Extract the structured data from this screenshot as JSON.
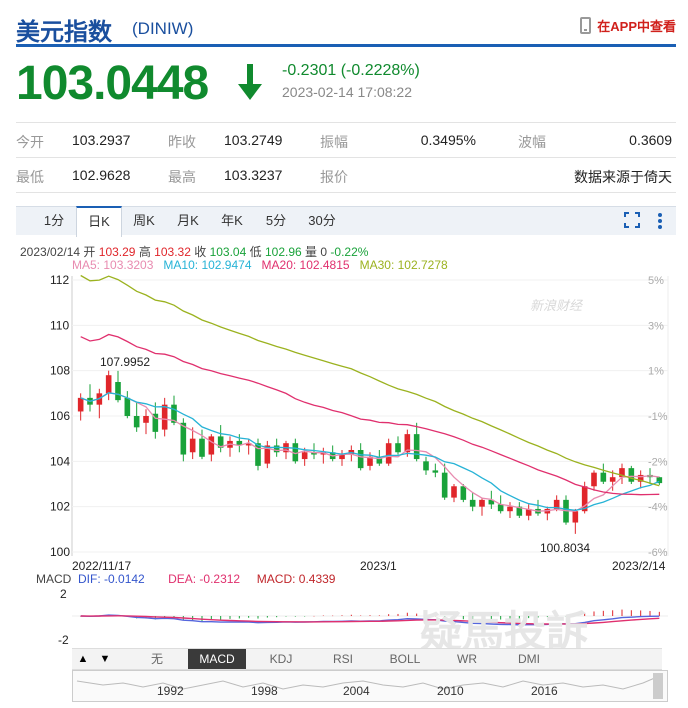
{
  "header": {
    "title": "美元指数",
    "code": "(DINIW)",
    "app_link": "在APP中查看"
  },
  "quote": {
    "price": "103.0448",
    "change": "-0.2301 (-0.2228%)",
    "time": "2023-02-14 17:08:22"
  },
  "stats": {
    "open_label": "今开",
    "open": "103.2937",
    "prev_label": "昨收",
    "prev": "103.2749",
    "amp_label": "振幅",
    "amp": "0.3495%",
    "wave_label": "波幅",
    "wave": "0.3609",
    "low_label": "最低",
    "low": "102.9628",
    "high_label": "最高",
    "high": "103.3237",
    "report_label": "报价",
    "source": "数据来源于倚天"
  },
  "tabs": [
    "1分",
    "日K",
    "周K",
    "月K",
    "年K",
    "5分",
    "30分"
  ],
  "active_tab": "日K",
  "info": {
    "date": "2023/02/14",
    "open_l": "开",
    "open": "103.29",
    "high_l": "高",
    "high": "103.32",
    "close_l": "收",
    "close": "103.04",
    "low_l": "低",
    "low": "102.96",
    "vol_l": "量",
    "vol": "0",
    "chg": "-0.22%"
  },
  "ma": {
    "ma5": "MA5: 103.3203",
    "ma10": "MA10: 102.9474",
    "ma20": "MA20: 102.4815",
    "ma30": "MA30: 102.7278"
  },
  "macd_info": {
    "label": "MACD",
    "dif": "DIF: -0.0142",
    "dea": "DEA: -0.2312",
    "macd": "MACD: 0.4339"
  },
  "indicators": [
    "无",
    "MACD",
    "KDJ",
    "RSI",
    "BOLL",
    "WR",
    "DMI"
  ],
  "active_indicator": "MACD",
  "nav_years": [
    "1992",
    "1998",
    "2004",
    "2010",
    "2016"
  ],
  "watermark": "新浪财经",
  "watermark2": "疑馬投訴",
  "colors": {
    "up": "#e0262b",
    "down": "#19a23a",
    "ma5": "#e88bb0",
    "ma10": "#27b3d6",
    "ma20": "#e0306e",
    "ma30": "#9bb21f",
    "dif": "#3355cc",
    "dea": "#e0306e"
  },
  "chart_data": {
    "type": "candlestick",
    "y_axis": {
      "ticks": [
        112,
        110,
        108,
        106,
        104,
        102,
        100
      ],
      "ylim": [
        100,
        112
      ]
    },
    "y_axis_right": {
      "ticks": [
        "5%",
        "3%",
        "1%",
        "-1%",
        "-2%",
        "-4%",
        "-6%"
      ]
    },
    "x_labels": [
      "2022/11/17",
      "2023/1",
      "2023/2/14"
    ],
    "annotations": {
      "max": "107.9952",
      "min": "100.8034"
    },
    "ohlc": [
      [
        106.2,
        107.0,
        105.8,
        106.8
      ],
      [
        106.8,
        107.4,
        106.2,
        106.5
      ],
      [
        106.5,
        107.2,
        105.9,
        107.0
      ],
      [
        107.0,
        108.0,
        106.7,
        107.8
      ],
      [
        107.5,
        107.99,
        106.6,
        106.7
      ],
      [
        106.8,
        107.1,
        105.9,
        106.0
      ],
      [
        106.0,
        106.6,
        105.3,
        105.5
      ],
      [
        105.7,
        106.3,
        105.2,
        106.0
      ],
      [
        106.1,
        106.6,
        105.0,
        105.3
      ],
      [
        105.4,
        106.8,
        105.1,
        106.5
      ],
      [
        106.5,
        106.9,
        105.6,
        105.7
      ],
      [
        105.7,
        105.9,
        104.0,
        104.3
      ],
      [
        104.4,
        105.5,
        104.1,
        105.0
      ],
      [
        105.0,
        105.4,
        104.1,
        104.2
      ],
      [
        104.3,
        105.2,
        104.0,
        105.1
      ],
      [
        105.1,
        105.6,
        104.4,
        104.6
      ],
      [
        104.6,
        105.1,
        104.2,
        104.9
      ],
      [
        104.9,
        105.2,
        104.4,
        104.7
      ],
      [
        104.7,
        105.0,
        104.3,
        104.8
      ],
      [
        104.8,
        105.0,
        103.6,
        103.8
      ],
      [
        103.9,
        104.9,
        103.7,
        104.7
      ],
      [
        104.7,
        105.0,
        104.2,
        104.4
      ],
      [
        104.4,
        104.9,
        104.1,
        104.8
      ],
      [
        104.8,
        105.0,
        103.9,
        104.0
      ],
      [
        104.1,
        104.6,
        103.8,
        104.4
      ],
      [
        104.4,
        104.8,
        104.1,
        104.3
      ],
      [
        104.3,
        104.6,
        103.9,
        104.4
      ],
      [
        104.4,
        104.7,
        104.0,
        104.1
      ],
      [
        104.1,
        104.5,
        103.8,
        104.3
      ],
      [
        104.3,
        104.7,
        104.0,
        104.5
      ],
      [
        104.5,
        104.8,
        103.6,
        103.7
      ],
      [
        103.8,
        104.4,
        103.6,
        104.2
      ],
      [
        104.2,
        104.5,
        103.8,
        103.9
      ],
      [
        103.9,
        105.0,
        103.8,
        104.8
      ],
      [
        104.8,
        105.1,
        104.3,
        104.4
      ],
      [
        104.4,
        105.4,
        104.2,
        105.2
      ],
      [
        105.2,
        105.7,
        104.0,
        104.1
      ],
      [
        104.0,
        104.2,
        103.4,
        103.6
      ],
      [
        103.6,
        103.9,
        103.3,
        103.5
      ],
      [
        103.5,
        103.9,
        102.3,
        102.4
      ],
      [
        102.4,
        103.0,
        102.2,
        102.9
      ],
      [
        102.9,
        103.0,
        102.2,
        102.3
      ],
      [
        102.3,
        102.6,
        101.8,
        102.0
      ],
      [
        102.0,
        102.4,
        101.6,
        102.3
      ],
      [
        102.3,
        102.7,
        101.9,
        102.1
      ],
      [
        102.1,
        102.5,
        101.7,
        101.8
      ],
      [
        101.8,
        102.2,
        101.5,
        102.0
      ],
      [
        102.0,
        102.2,
        101.5,
        101.6
      ],
      [
        101.6,
        102.1,
        101.4,
        101.9
      ],
      [
        101.9,
        102.3,
        101.6,
        101.7
      ],
      [
        101.7,
        102.0,
        101.4,
        101.9
      ],
      [
        101.9,
        102.5,
        101.8,
        102.3
      ],
      [
        102.3,
        102.5,
        101.2,
        101.3
      ],
      [
        101.3,
        101.9,
        100.8,
        101.8
      ],
      [
        101.8,
        103.1,
        101.7,
        102.9
      ],
      [
        102.9,
        103.6,
        102.7,
        103.5
      ],
      [
        103.5,
        103.9,
        103.0,
        103.1
      ],
      [
        103.1,
        103.6,
        102.7,
        103.3
      ],
      [
        103.3,
        103.9,
        103.0,
        103.7
      ],
      [
        103.7,
        103.8,
        103.0,
        103.1
      ],
      [
        103.1,
        103.6,
        102.8,
        103.4
      ],
      [
        103.4,
        103.7,
        103.0,
        103.3
      ],
      [
        103.3,
        103.32,
        102.96,
        103.04
      ]
    ]
  }
}
